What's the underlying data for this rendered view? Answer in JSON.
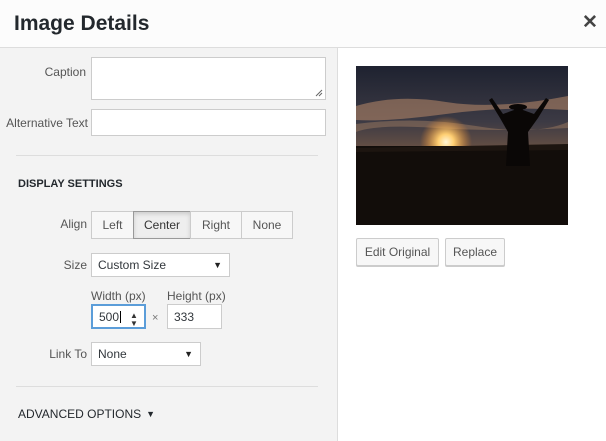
{
  "modal": {
    "title": "Image Details",
    "close_icon": "close-icon"
  },
  "fields": {
    "caption": {
      "label": "Caption",
      "value": ""
    },
    "alt_text": {
      "label": "Alternative Text",
      "value": ""
    }
  },
  "display_settings": {
    "heading": "DISPLAY SETTINGS",
    "align": {
      "label": "Align",
      "options": [
        "Left",
        "Center",
        "Right",
        "None"
      ],
      "selected": "Center"
    },
    "size": {
      "label": "Size",
      "value": "Custom Size"
    },
    "width": {
      "label": "Width (px)",
      "value": "500"
    },
    "height": {
      "label": "Height (px)",
      "value": "333"
    },
    "times": "×",
    "link_to": {
      "label": "Link To",
      "value": "None"
    }
  },
  "advanced": {
    "label": "ADVANCED OPTIONS",
    "icon": "caret-down-icon"
  },
  "preview": {
    "image_icon": "sunset-silhouette-image",
    "edit_original_label": "Edit Original",
    "replace_label": "Replace"
  }
}
